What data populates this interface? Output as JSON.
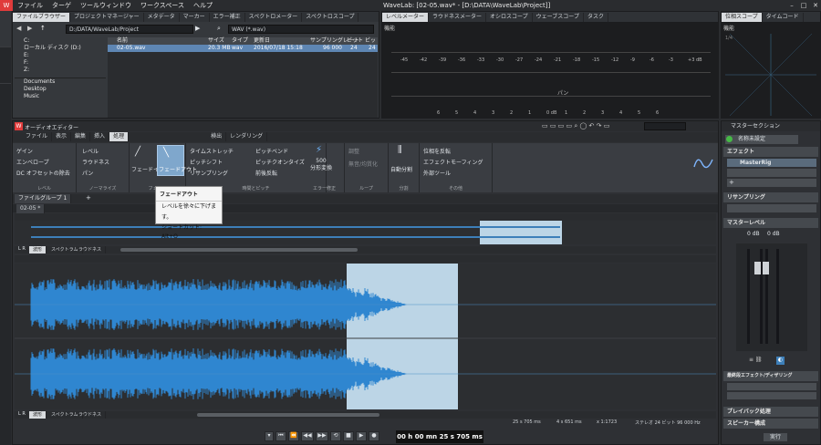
{
  "app": {
    "title": "WaveLab: [02-05.wav* - [D:\\DATA\\WaveLab\\Project]]",
    "menu": [
      "ファイル",
      "ターゲ",
      "ツールウィンドウ",
      "ワークスペース",
      "ヘルプ"
    ],
    "left_strip_labels": [
      "プロジェクト"
    ]
  },
  "file_browser": {
    "tabs": [
      "ファイルブラウザー",
      "プロジェクトマネージャー",
      "メタデータ",
      "マーカー",
      "エラー補正",
      "スペクトロメーター",
      "スペクトロスコープ"
    ],
    "path": "D:/DATA/WaveLab/Project",
    "filter": "WAV (*.wav)",
    "tree": [
      "C:",
      "ローカル ディスク (D:)",
      "E:",
      "F:",
      "Z:"
    ],
    "places": [
      "Documents",
      "Desktop",
      "Music"
    ],
    "columns": [
      "名前",
      "サイズ",
      "タイプ",
      "更新日",
      "サンプリングレート",
      "ビット",
      "ビット"
    ],
    "row": [
      "02-05.wav",
      "20.3 MB",
      "wav",
      "2016/07/18 15:18",
      "96 000",
      "24",
      "24"
    ]
  },
  "level_meter": {
    "tabs": [
      "レベルメーター",
      "ラウドネスメーター",
      "オシロスコープ",
      "ウェーブスコープ",
      "タスク"
    ],
    "tool_label": "機能",
    "scale": [
      "-45",
      "-42",
      "-39",
      "-36",
      "-33",
      "-30",
      "-27",
      "-24",
      "-21",
      "-18",
      "-15",
      "-12",
      "-9",
      "-6",
      "-3",
      "+3 dB"
    ],
    "pan_label": "パン",
    "bottom_scale": [
      "6",
      "5",
      "4",
      "3",
      "2",
      "1",
      "0 dB",
      "1",
      "2",
      "3",
      "4",
      "5",
      "6"
    ]
  },
  "phasescope": {
    "tabs": [
      "位相スコープ",
      "タイムコード"
    ],
    "tool_label": "機能",
    "corner": "1/4"
  },
  "audio_editor": {
    "title": "オーディオエディター",
    "tabs": [
      "ファイル",
      "表示",
      "編集",
      "挿入",
      "処理",
      "検出",
      "レンダリング"
    ],
    "groups": [
      "レベル",
      "ノーマライズ",
      "フェード",
      "時間とピッチ",
      "エラー修正",
      "ループ",
      "分割",
      "その他"
    ],
    "items": {
      "gain": "ゲイン",
      "envelope": "エンベロープ",
      "dc": "DC オフセットの除去",
      "level": "レベル",
      "loudness": "ラウドネス",
      "pan": "パン",
      "fadein": "フェードイン",
      "fadeout": "フェードアウト",
      "timestretch": "タイムストレッチ",
      "pitchshift": "ピッチシフト",
      "resample": "リサンプリング",
      "pitchbend": "ピッチベンド",
      "pitchquant": "ピッチクオンタイズ",
      "reverse": "前後反転",
      "convert": "500\n分形変換",
      "adjust": "調整",
      "silence": "無音/均質化",
      "autosplit": "自動分割",
      "phase": "位相を反転",
      "effectmorph": "エフェクトモーフィング",
      "external": "外部ツール"
    },
    "file_group": "ファイルグループ 1",
    "doc_tab": "02-05 *",
    "view_tabs": [
      "波形",
      "スペクトラム",
      "ラウドネス"
    ],
    "tooltip": {
      "title": "フェードアウト",
      "desc": "レベルを徐々に下げます。",
      "shortcut": "ショートカット: Alt+O"
    },
    "status": [
      "25 s 705 ms",
      "4 s 651 ms",
      "x 1:1723",
      "ステレオ 24 ビット 96 000 Hz"
    ],
    "lr_label": "L R"
  },
  "transport": {
    "time": "00 h 00 mn 25 s 705 ms"
  },
  "master": {
    "title": "マスターセクション",
    "preset": "名称未設定",
    "effects_label": "エフェクト",
    "plugin": "MasterRig",
    "resampling": "リサンプリング",
    "master_level": "マスターレベル",
    "level_values": [
      "0 dB",
      "0 dB"
    ],
    "final_effects": "最終段エフェクト/ディザリング",
    "playback": "プレイバック処理",
    "speaker": "スピーカー構成",
    "render": "実行"
  }
}
